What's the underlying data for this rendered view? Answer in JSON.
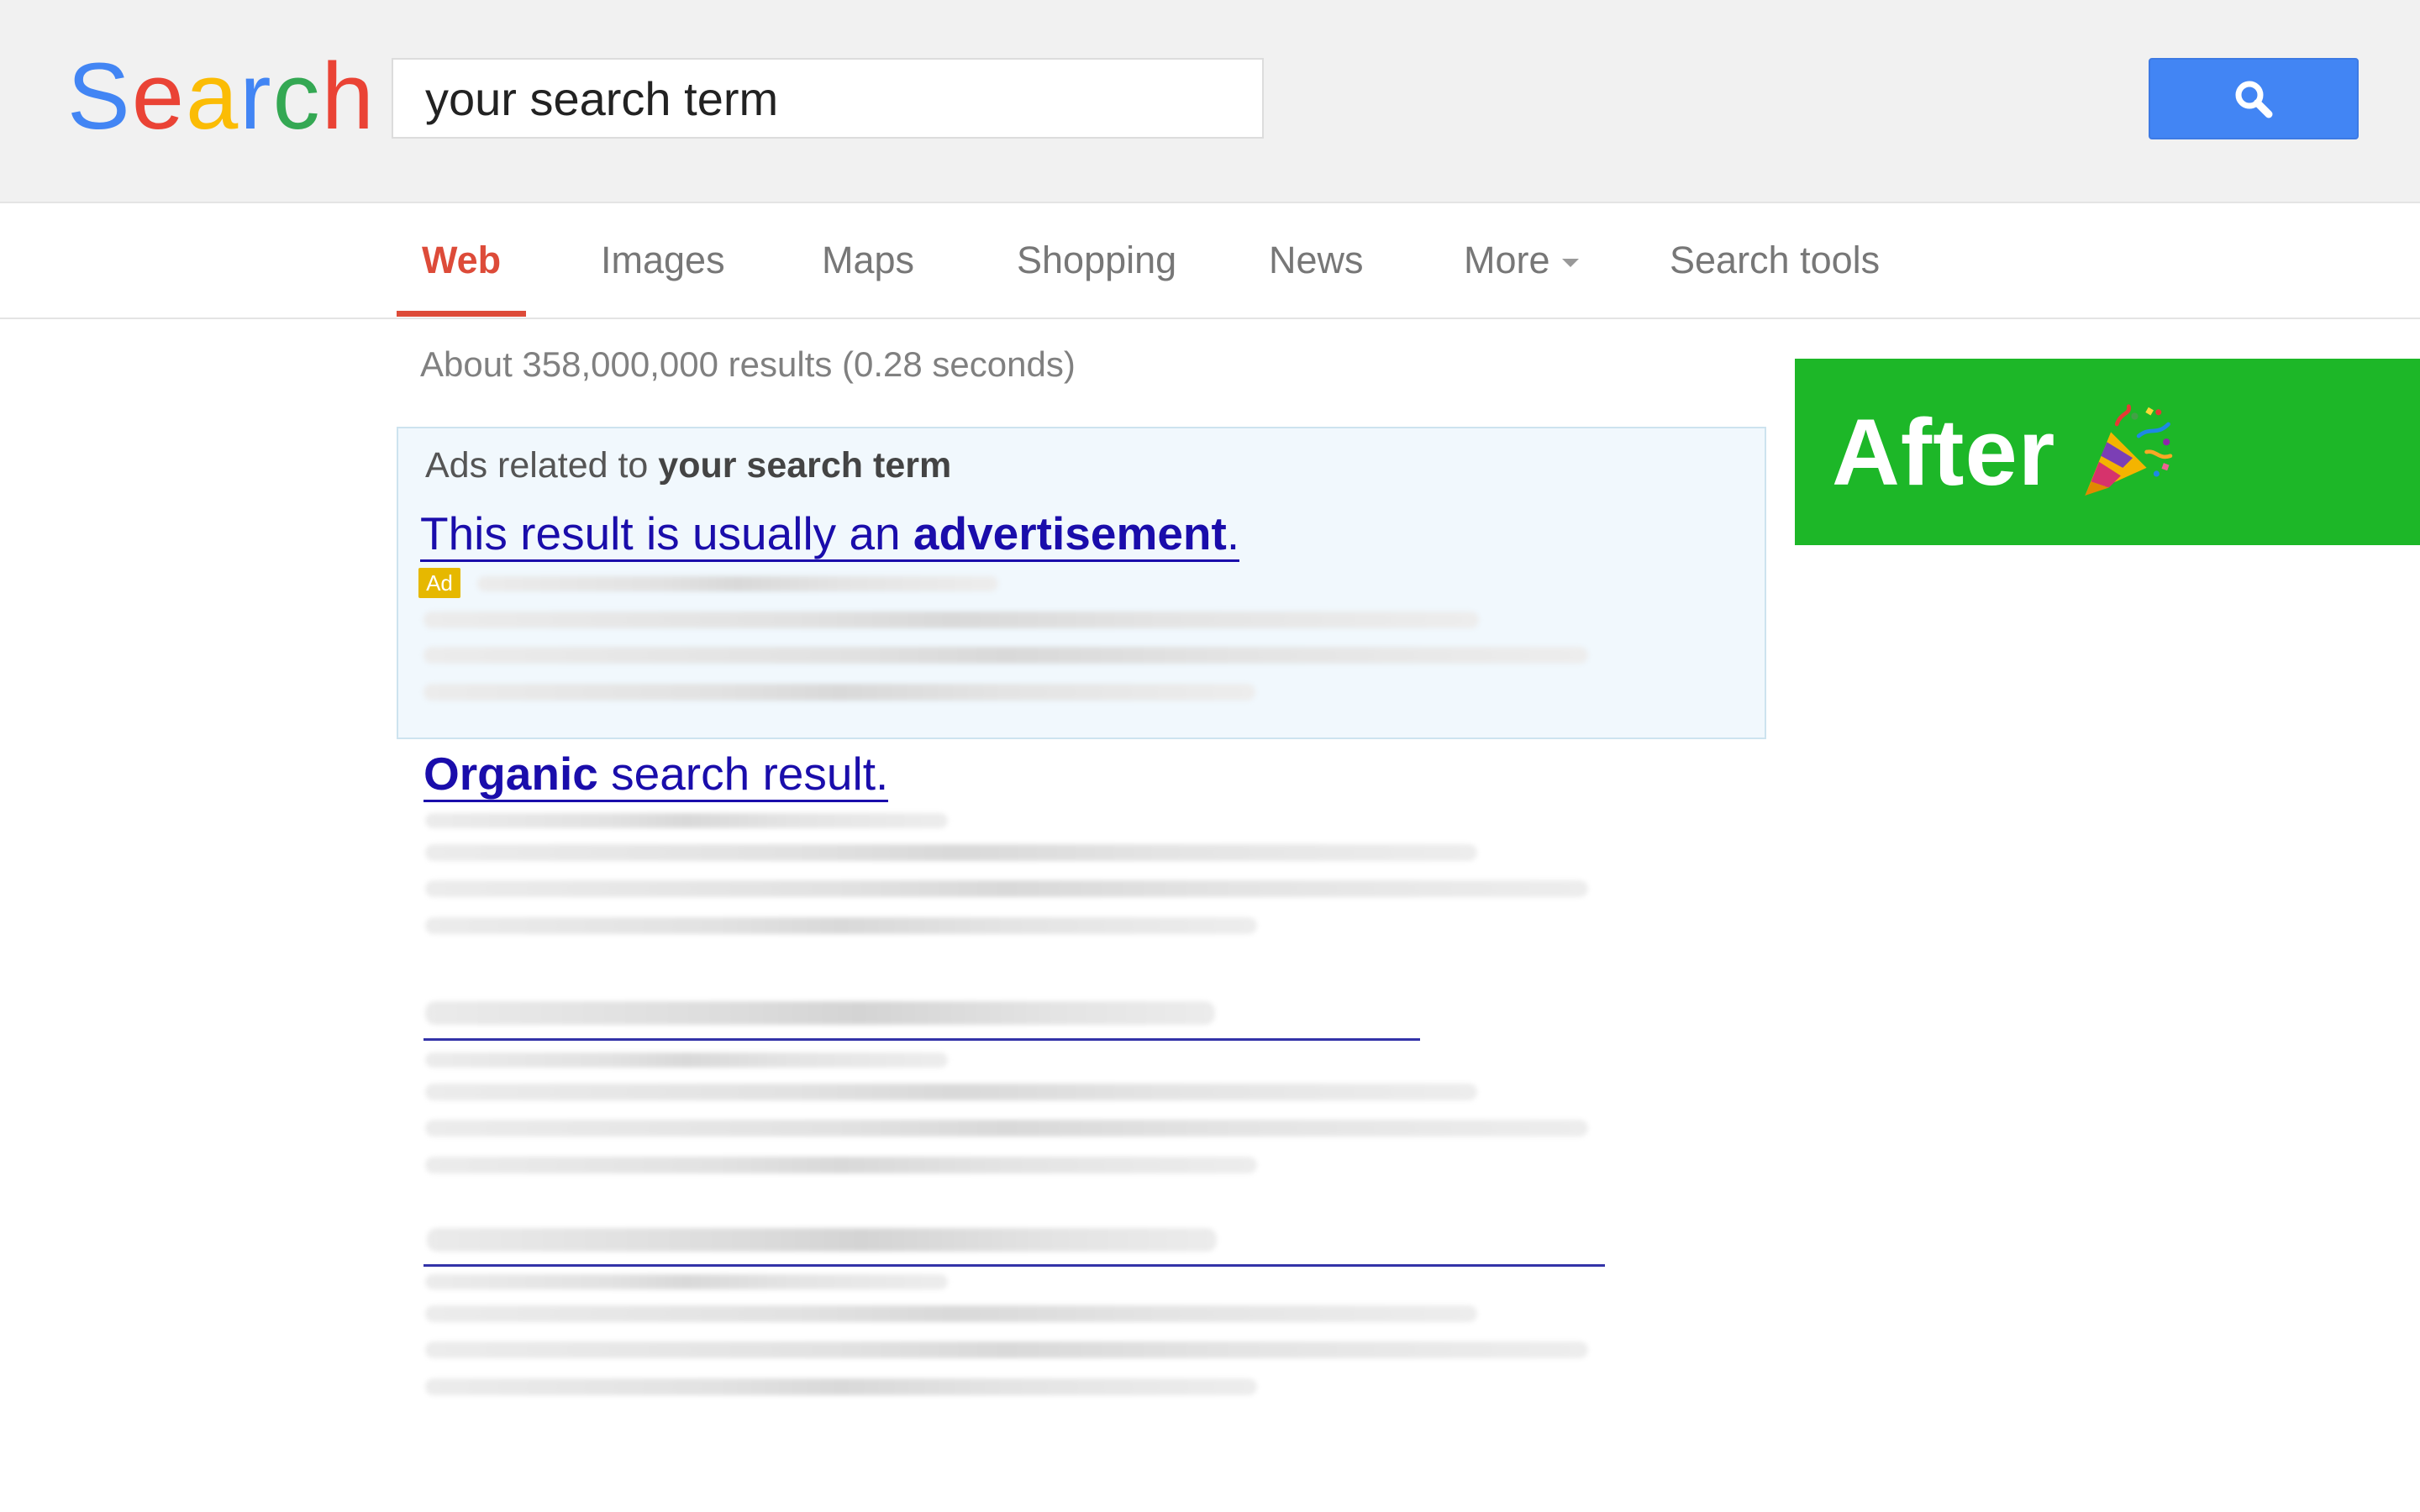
{
  "header": {
    "logo_letters": [
      {
        "char": "S",
        "color": "#4285f4"
      },
      {
        "char": "e",
        "color": "#ea4335"
      },
      {
        "char": "a",
        "color": "#fbbc05"
      },
      {
        "char": "r",
        "color": "#4285f4"
      },
      {
        "char": "c",
        "color": "#34a853"
      },
      {
        "char": "h",
        "color": "#ea4335"
      }
    ],
    "search_value": "your search term",
    "search_button_icon": "magnifier-icon"
  },
  "tabs": {
    "web": "Web",
    "images": "Images",
    "maps": "Maps",
    "shopping": "Shopping",
    "news": "News",
    "more": "More",
    "search_tools": "Search tools"
  },
  "results": {
    "stats": "About 358,000,000 results (0.28 seconds)",
    "ad_heading_prefix": "Ads related to ",
    "ad_heading_term": "your search term",
    "ad_title_prefix": "This result is usually an ",
    "ad_title_bold": "advertisement",
    "ad_title_suffix": ".",
    "ad_badge": "Ad",
    "organic_title_bold": "Organic",
    "organic_title_rest": " search result."
  },
  "banner": {
    "text": "After",
    "icon": "party-popper-icon"
  },
  "colors": {
    "accent_red": "#dd4b39",
    "link_blue": "#1a0dab",
    "button_blue": "#4285f4",
    "banner_green": "#1db728",
    "ad_badge": "#e6b800"
  }
}
